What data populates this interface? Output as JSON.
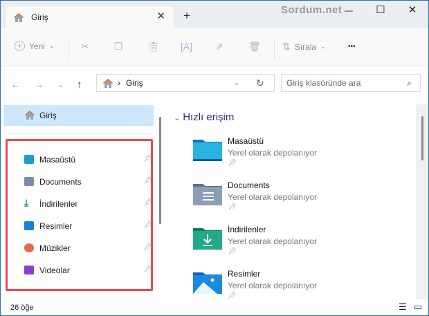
{
  "window": {
    "tab_title": "Giriş",
    "watermark": "Sordum.net",
    "close": "✕",
    "minimize": "—",
    "maximize": "☐",
    "new_tab": "+"
  },
  "toolbar": {
    "new_label": "Yeni",
    "sort_label": "Sırala",
    "more": "•••"
  },
  "nav": {
    "address": "Giriş",
    "search_placeholder": "Giriş klasöründe ara"
  },
  "sidebar": {
    "home": "Giriş",
    "items": [
      {
        "label": "Masaüstü",
        "color": "#1e9ad6"
      },
      {
        "label": "Documents",
        "color": "#7b8ea8"
      },
      {
        "label": "İndirilenler",
        "color": "#1aa36a"
      },
      {
        "label": "Resimler",
        "color": "#1a7fd6"
      },
      {
        "label": "Müzikler",
        "color": "#e8684a"
      },
      {
        "label": "Videolar",
        "color": "#8a3fd1"
      }
    ]
  },
  "main": {
    "section": "Hızlı erişim",
    "items": [
      {
        "name": "Masaüstü",
        "sub": "Yerel olarak depolanıyor"
      },
      {
        "name": "Documents",
        "sub": "Yerel olarak depolanıyor"
      },
      {
        "name": "İndirilenler",
        "sub": "Yerel olarak depolanıyor"
      },
      {
        "name": "Resimler",
        "sub": "Yerel olarak depolanıyor"
      }
    ]
  },
  "status": {
    "count": "26 öğe"
  }
}
